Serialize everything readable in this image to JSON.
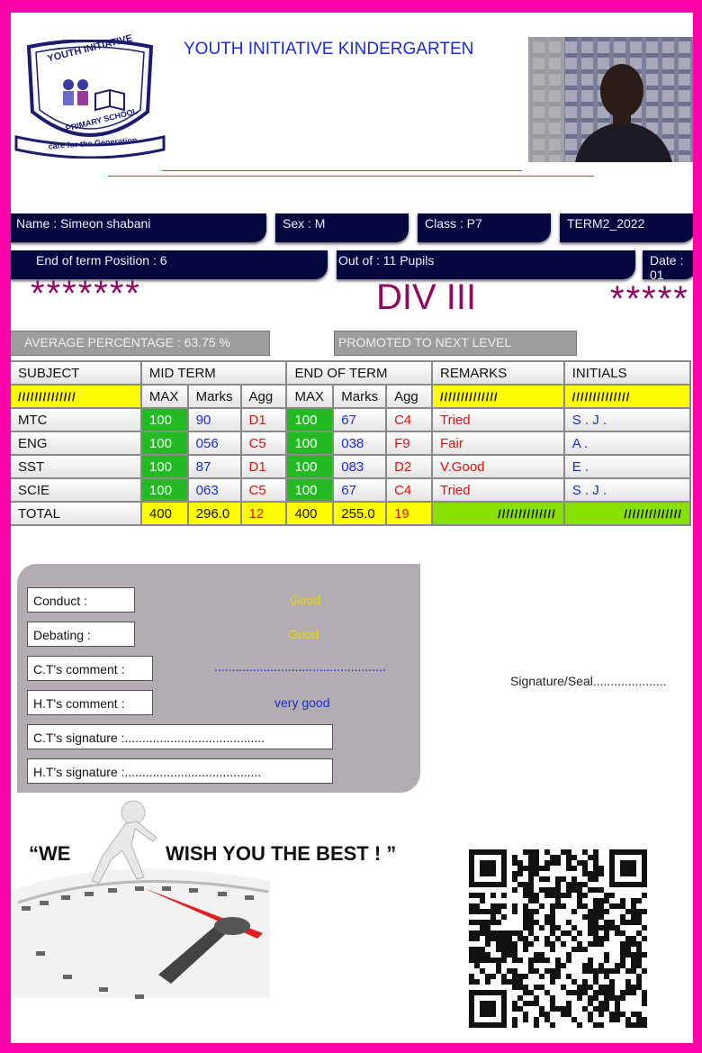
{
  "school": {
    "name": "YOUTH INITIATIVE KINDERGARTEN",
    "logo_top_text": "YOUTH INITIATIVE",
    "logo_bottom_text": "PRIMARY SCHOOL",
    "logo_ribbon_text": "care for the Generation"
  },
  "pupil": {
    "name": "Name :  Simeon shabani",
    "sex": "Sex :  M",
    "class": "Class :  P7",
    "term": "TERM2_2022",
    "position": "End of term Position : 6",
    "out_of": "Out of : 11 Pupils",
    "date": "Date : 01"
  },
  "result": {
    "stars_left": "*******",
    "division": "DIV III",
    "stars_right": "*****",
    "average": "AVERAGE PERCENTAGE :  63.75 %",
    "promotion": "PROMOTED TO NEXT LEVEL"
  },
  "table": {
    "headers": {
      "subject": "SUBJECT",
      "mid": "MID TERM",
      "end": "END OF TERM",
      "remarks": "REMARKS",
      "initials": "INITIALS"
    },
    "sub": {
      "max": "MAX",
      "marks": "Marks",
      "agg": "Agg",
      "hatch": "//////////////"
    },
    "rows": [
      {
        "subject": "MTC",
        "mid_max": "100",
        "mid_marks": "90",
        "mid_agg": "D1",
        "end_max": "100",
        "end_marks": "67",
        "end_agg": "C4",
        "remark": "Tried",
        "initials": "S . J ."
      },
      {
        "subject": "ENG",
        "mid_max": "100",
        "mid_marks": "056",
        "mid_agg": "C5",
        "end_max": "100",
        "end_marks": "038",
        "end_agg": "F9",
        "remark": "Fair",
        "initials": "A ."
      },
      {
        "subject": "SST",
        "mid_max": "100",
        "mid_marks": "87",
        "mid_agg": "D1",
        "end_max": "100",
        "end_marks": "083",
        "end_agg": "D2",
        "remark": "V.Good",
        "initials": "E ."
      },
      {
        "subject": "SCIE",
        "mid_max": "100",
        "mid_marks": "063",
        "mid_agg": "C5",
        "end_max": "100",
        "end_marks": "67",
        "end_agg": "C4",
        "remark": "Tried",
        "initials": "S . J ."
      }
    ],
    "total": {
      "label": "TOTAL",
      "mid_max": "400",
      "mid_marks": "296.0",
      "mid_agg": "12",
      "end_max": "400",
      "end_marks": "255.0",
      "end_agg": "19"
    }
  },
  "comments": {
    "conduct_label": "Conduct :",
    "conduct_value": "Good",
    "debating_label": "Debating :",
    "debating_value": "Good",
    "ct_comment_label": "C.T's comment :",
    "ct_comment_value": ".................................................",
    "ht_comment_label": "H.T's comment :",
    "ht_comment_value": "very good",
    "ct_signature": "C.T's signature :........................................",
    "ht_signature": "H.T's signature :......................................."
  },
  "signature_seal": "Signature/Seal.....................",
  "motto": {
    "part1": "“WE",
    "part2": "WISH YOU THE BEST ! ”"
  },
  "colors": {
    "border": "#ff00aa",
    "navy": "#05063d",
    "division": "#8e0a5e",
    "green": "#22bb22",
    "yellow": "#ffff00"
  }
}
